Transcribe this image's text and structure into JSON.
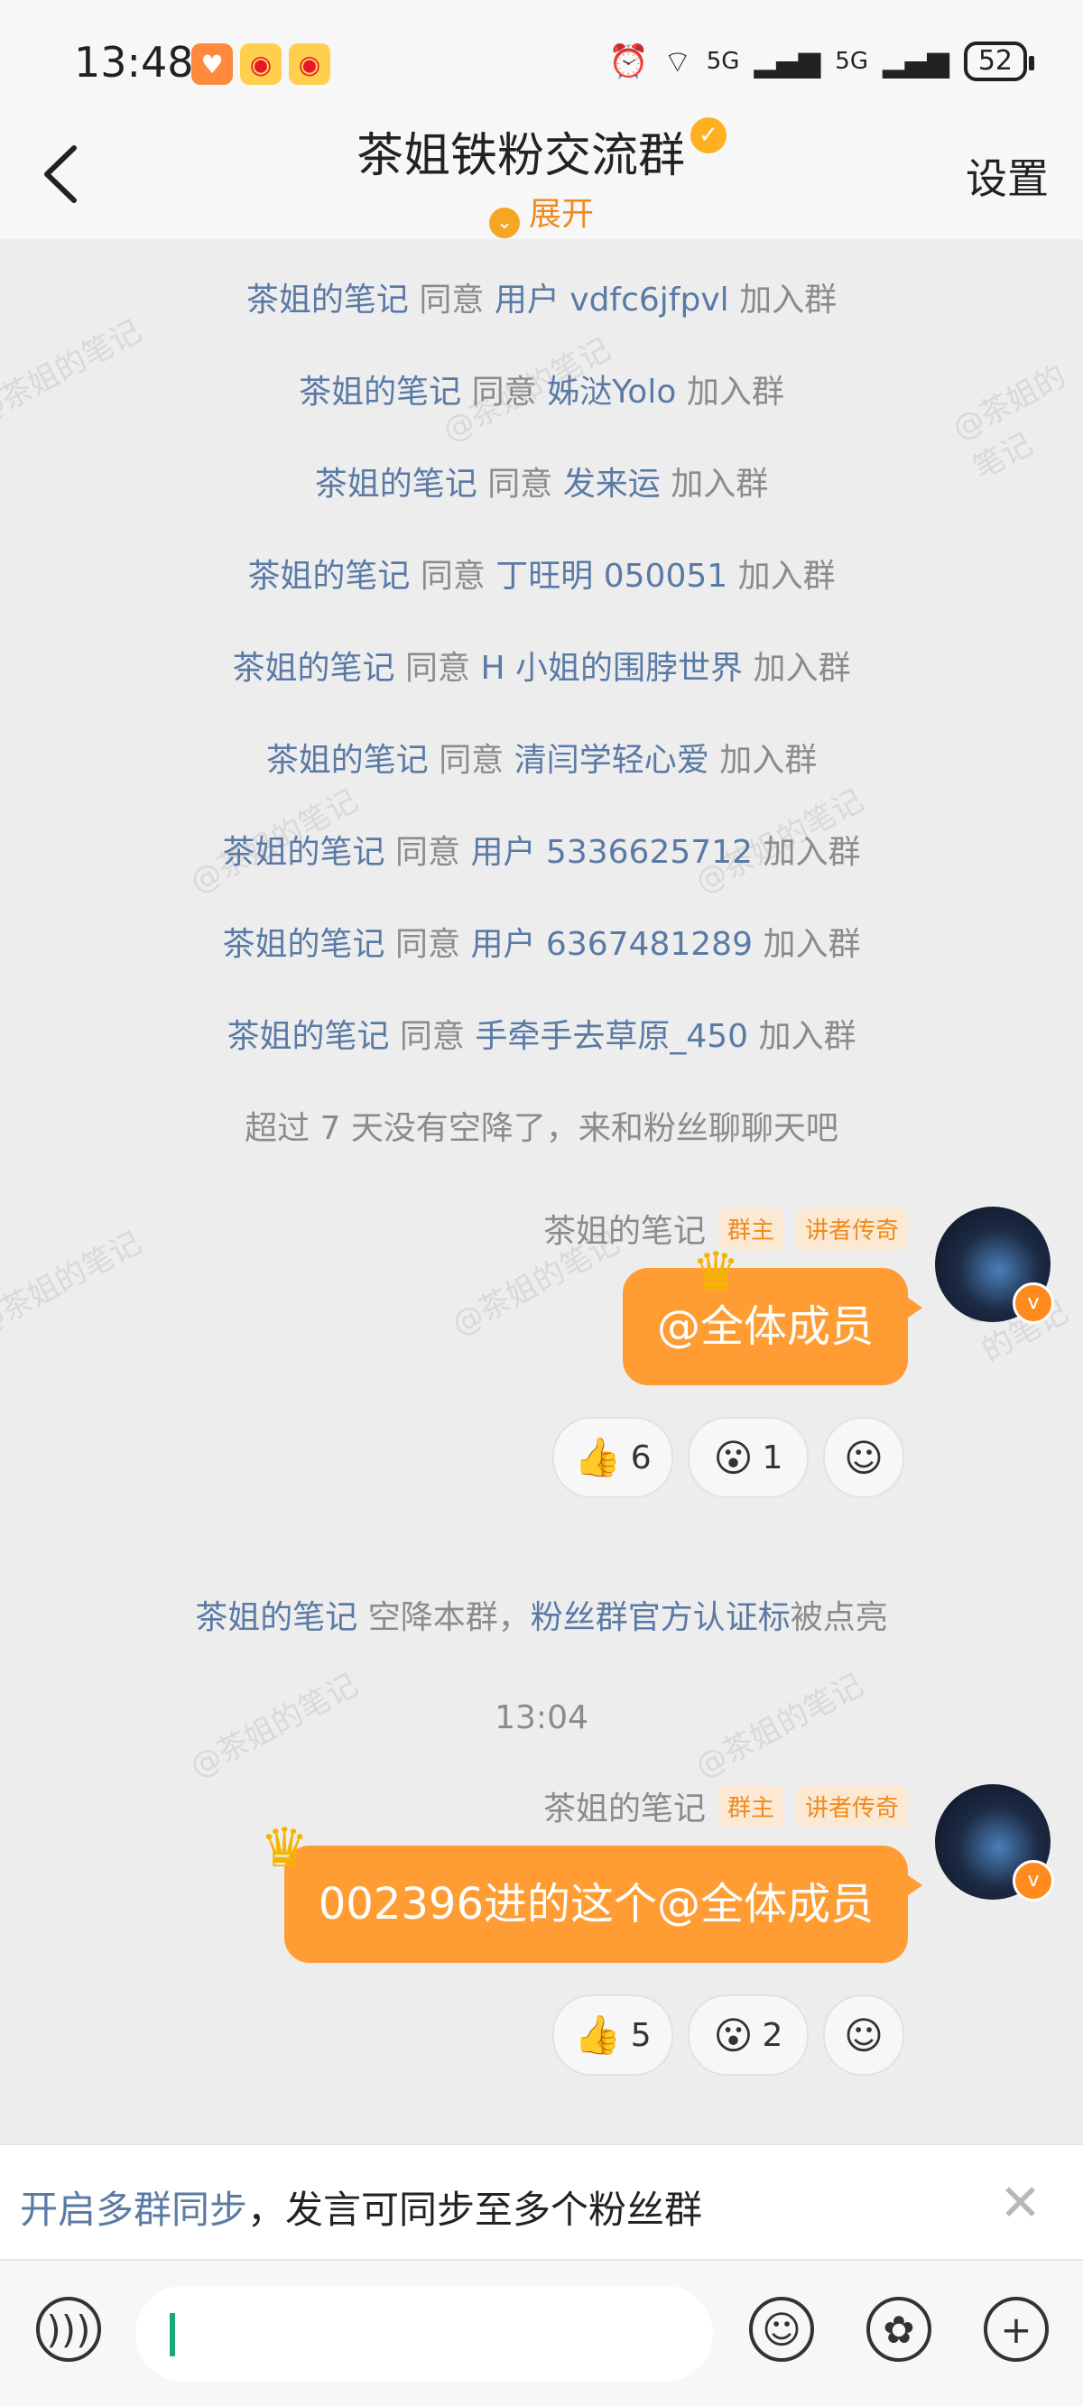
{
  "status_bar": {
    "time": "13:48",
    "network1": "5G",
    "network2": "5G",
    "battery": "52"
  },
  "header": {
    "title": "茶姐铁粉交流群",
    "expand_label": "展开",
    "settings_label": "设置"
  },
  "join_messages": [
    {
      "approver": "茶姐的笔记",
      "verb": "同意",
      "user": "用户 vdfc6jfpvl",
      "action": "加入群"
    },
    {
      "approver": "茶姐的笔记",
      "verb": "同意",
      "user": "姊㳠Yolo",
      "action": "加入群"
    },
    {
      "approver": "茶姐的笔记",
      "verb": "同意",
      "user": "发来运",
      "action": "加入群"
    },
    {
      "approver": "茶姐的笔记",
      "verb": "同意",
      "user": "丁旺明 050051",
      "action": "加入群"
    },
    {
      "approver": "茶姐的笔记",
      "verb": "同意",
      "user": "H 小姐的围脖世界",
      "action": "加入群"
    },
    {
      "approver": "茶姐的笔记",
      "verb": "同意",
      "user": "清闫学轻心爱",
      "action": "加入群"
    },
    {
      "approver": "茶姐的笔记",
      "verb": "同意",
      "user": "用户 5336625712",
      "action": "加入群"
    },
    {
      "approver": "茶姐的笔记",
      "verb": "同意",
      "user": "用户 6367481289",
      "action": "加入群"
    },
    {
      "approver": "茶姐的笔记",
      "verb": "同意",
      "user": "手牵手去草原_450",
      "action": "加入群"
    }
  ],
  "notice_idle": "超过 7 天没有空降了，来和粉丝聊聊天吧",
  "message1": {
    "sender": "茶姐的笔记",
    "tag_owner": "群主",
    "tag_title": "讲者传奇",
    "text": "@全体成员",
    "like_count": "6",
    "wow_count": "1"
  },
  "notice_airdrop": {
    "name": "茶姐的笔记",
    "middle": "空降本群，",
    "link": "粉丝群官方认证标",
    "tail": "被点亮"
  },
  "timestamp": "13:04",
  "message2": {
    "sender": "茶姐的笔记",
    "tag_owner": "群主",
    "tag_title": "讲者传奇",
    "text": "002396进的这个@全体成员",
    "like_count": "5",
    "wow_count": "2"
  },
  "sync_bar": {
    "link": "开启多群同步",
    "text": "，发言可同步至多个粉丝群"
  },
  "watermark_text": "@茶姐的笔记",
  "icons": [
    "back-chevron-icon",
    "verified-icon",
    "expand-icon",
    "voice-icon",
    "emoji-icon",
    "sticker-icon",
    "plus-icon",
    "close-icon",
    "crown-icon"
  ],
  "colors": {
    "accent": "#ff9d34",
    "link": "#5a7aa6",
    "background": "#ededed"
  }
}
